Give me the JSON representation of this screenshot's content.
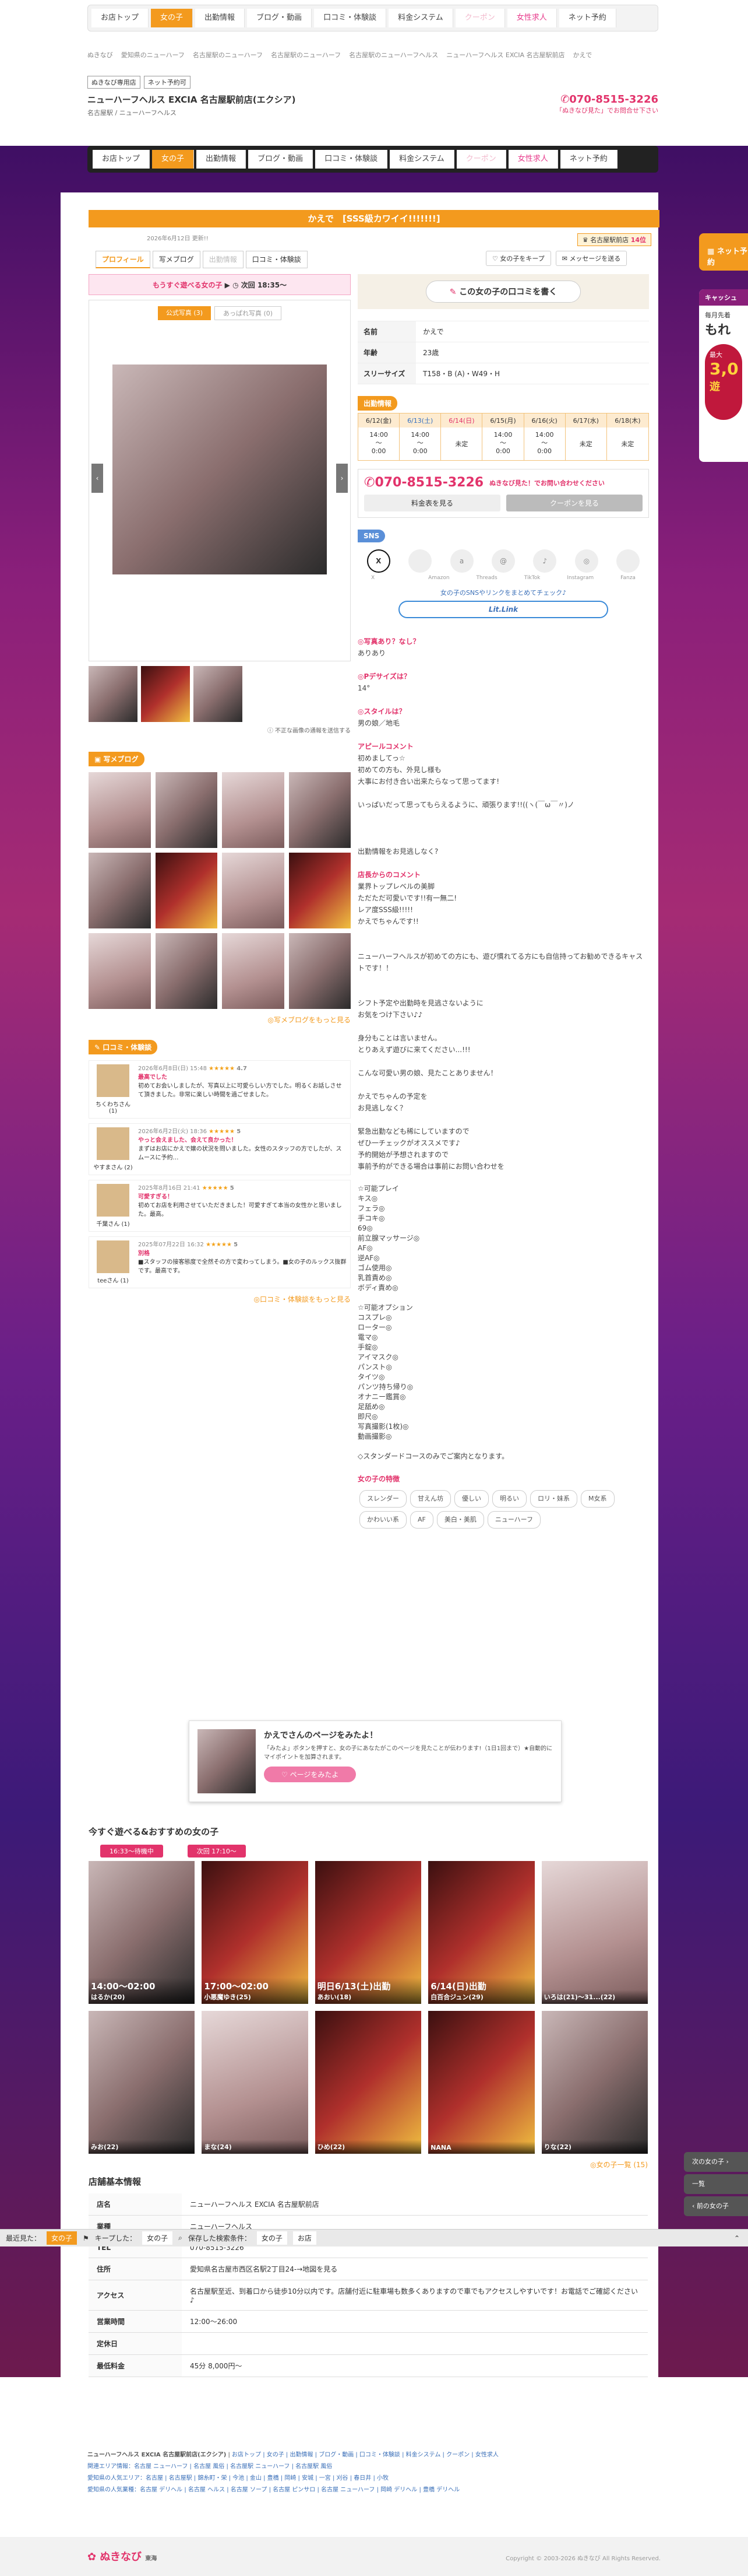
{
  "nav": {
    "items": [
      "お店トップ",
      "女の子",
      "出勤情報",
      "ブログ・動画",
      "口コミ・体験談",
      "料金システム",
      "クーポン",
      "女性求人",
      "ネット予約"
    ],
    "active": 1
  },
  "breadcrumb": [
    "ぬきなび",
    "愛知県のニューハーフ",
    "名古屋駅のニューハーフ",
    "名古屋駅のニューハーフ",
    "名古屋駅のニューハーフヘルス",
    "ニューハーフヘルス EXCIA 名古屋駅前店",
    "かえで"
  ],
  "shop": {
    "tags": [
      "ぬきなび専用店",
      "ネット予約可"
    ],
    "name": "ニューハーフヘルス EXCIA 名古屋駅前店(エクシア)",
    "area": "名古屋駅 / ニューハーフヘルス",
    "phone": "070-8515-3226",
    "note": "「ぬきなび見た」でお問合せ下さい"
  },
  "title": "かえで　[SSS級カワイイ!!!!!!!]",
  "date": "2026年6月12日 更新!!",
  "rank": {
    "label": "名古屋駅前店",
    "count": "14位"
  },
  "tabs": [
    "プロフィール",
    "写メブログ",
    "出勤情報",
    "口コミ・体験談"
  ],
  "top_buttons": {
    "fav": "女の子をキープ",
    "mail": "メッセージを送る"
  },
  "now": {
    "label": "もうすぐ遊べる女の子",
    "time": "次回 18:35〜"
  },
  "photo_tabs": [
    "公式写真 (3)",
    "あっぱれ写真 (0)"
  ],
  "photo_note": "不正な画像の通報を送信する",
  "review_btn": "この女の子の口コミを書く",
  "profile": {
    "rows": [
      {
        "k": "名前",
        "v": "かえで"
      },
      {
        "k": "年齢",
        "v": "23歳"
      },
      {
        "k": "スリーサイズ",
        "v": "T158・B (A)・W49・H"
      }
    ]
  },
  "schedule": {
    "title": "出勤情報",
    "days": [
      "6/12(金)",
      "6/13(土)",
      "6/14(日)",
      "6/15(月)",
      "6/16(火)",
      "6/17(水)",
      "6/18(木)"
    ],
    "times": [
      [
        "14:00",
        "〜",
        "0:00"
      ],
      [
        "14:00",
        "〜",
        "0:00"
      ],
      [
        "未定"
      ],
      [
        "14:00",
        "〜",
        "0:00"
      ],
      [
        "14:00",
        "〜",
        "0:00"
      ],
      [
        "未定"
      ],
      [
        "未定"
      ]
    ]
  },
  "contact": {
    "phone": "070-8515-3226",
    "note": "ぬきなび見た！でお問い合わせください",
    "price_btn": "料金表を見る",
    "coupon_btn": "クーポンを見る"
  },
  "sns": {
    "title": "SNS",
    "items": [
      "X",
      "",
      "Amazon",
      "Threads",
      "TikTok",
      "Instagram",
      "",
      "Fanza"
    ],
    "link_text": "女の子のSNSやリンクをまとめてチェック♪",
    "lit": "Lit.Link"
  },
  "qa": [
    {
      "q": "写真あり？なし？",
      "a": "ありあり"
    },
    {
      "q": "Pデサイズは？",
      "a": "14°"
    },
    {
      "q": "スタイルは？",
      "a": "男の娘／地毛"
    }
  ],
  "appeal": {
    "title": "アピールコメント",
    "lines": [
      "初めましてっ☆",
      "",
      "初めての方も、外見し様も",
      "大事にお付き合い出来たらなって思ってます!",
      "",
      "いっぱいだって思ってもらえるように、頑張ります!!((ヽ(￣ω￣〃)ノ",
      "",
      "",
      "",
      "出勤情報をお見逃しなく?"
    ]
  },
  "shop_comment": {
    "title": "店長からのコメント",
    "lines": [
      "業界トップレベルの美脚",
      "ただただ可愛いです!!有一無二!",
      "レア度SSS級!!!!!",
      "かえでちゃんです!!",
      "",
      "",
      "ニューハーフヘルスが初めての方にも、遊び慣れてる方にも自信持ってお勧めできるキャストです！！",
      "",
      "",
      "シフト予定や出勤時を見逃さないように",
      "お気をつけ下さい♪♪",
      "",
      "身分もことは言いません。",
      "とりあえず遊びに来てください...!!!",
      "",
      "こんな可愛い男の娘、見たことありません！",
      "",
      "かえでちゃんの予定を",
      "お見逃しなく？",
      "",
      "緊急出勤なども稀にしていますので",
      "ぜひ一チェックがオススメです♪",
      "予約開始が予想されますので",
      "事前予約ができる場合は事前にお問い合わせを"
    ]
  },
  "options": {
    "title": "☆可能プレイ",
    "lines": [
      "キス◎",
      "フェラ◎",
      "手コキ◎",
      "69◎",
      "前立腺マッサージ◎",
      "AF◎",
      "逆AF◎",
      "ゴム使用◎",
      "乳首責め◎",
      "ボディ責め◎"
    ],
    "title2": "☆可能オプション",
    "lines2": [
      "コスプレ◎",
      "ローター◎",
      "電マ◎",
      "手錠◎",
      "アイマスク◎",
      "パンスト◎",
      "タイツ◎",
      "パンツ持ち帰り◎",
      "オナニー鑑賞◎",
      "足舐め◎",
      "即尺◎",
      "写真撮影(1枚)◎",
      "動画撮影◎"
    ],
    "footer": "◇スタンダードコースのみでご案内となります。"
  },
  "features": {
    "title": "女の子の特徴",
    "items": [
      "スレンダー",
      "甘えん坊",
      "優しい",
      "明るい",
      "ロリ・妹系",
      "M女系",
      "かわいい系",
      "AF",
      "美白・美肌",
      "ニューハーフ"
    ]
  },
  "blog": {
    "title": "写メブログ",
    "more": "写メブログをもっと見る"
  },
  "reviews": {
    "title": "口コミ・体験談",
    "items": [
      {
        "user": "ちくわちさん (1)",
        "date": "2026年6月8日(日) 15:48",
        "rating": "4.7",
        "title": "最高でした",
        "text": "初めてお会いしましたが、写真以上に可愛らしい方でした。明るくお話しさせて頂きました。非常に楽しい時間を過ごせました。"
      },
      {
        "user": "やすまさん (2)",
        "date": "2026年6月2日(火) 18:36",
        "rating": "5",
        "title": "やっと会えました、会えて良かった！",
        "text": "まずはお店にかえで嬢の状況を問いました。女性のスタッフの方でしたが、スムースに予約…"
      },
      {
        "user": "千葉さん (1)",
        "date": "2025年8月16日 21:41",
        "rating": "5",
        "title": "可愛すぎる！",
        "text": "初めてお店を利用させていただきました！可愛すぎて本当の女性かと思いました。最高。"
      },
      {
        "user": "teeさん (1)",
        "date": "2025年07月22日 16:32",
        "rating": "5",
        "title": "別格",
        "text": "■スタッフの接客態度で全然その方で変わってしまう。■女の子のルックス抜群です。最高です。"
      }
    ],
    "more": "口コミ・体験談をもっと見る"
  },
  "promo": {
    "title": "かえでさんのページをみたよ！",
    "text": "「みたよ」ボタンを押すと、女の子にあなたがこのページを見たことが伝わります!（1日1回まで）★自動的にマイポイントを加算されます。",
    "btn": "ページをみたよ"
  },
  "recommend": {
    "title": "今すぐ遊べる&おすすめの女の子",
    "badges": [
      "16:33〜待機中",
      "次回 17:10〜"
    ],
    "cards": [
      {
        "time": "14:00〜02:00",
        "name": "はるか(20)"
      },
      {
        "time": "17:00〜02:00",
        "name": "小悪魔ゆき(25)"
      },
      {
        "time": "明日6/13(土)出勤",
        "name": "あおい(18)"
      },
      {
        "time": "6/14(日)出勤",
        "name": "白百合ジュン(29)"
      },
      {
        "time": "",
        "name": "いろは(21)〜31...(22)"
      },
      {
        "time": "",
        "name": "みお(22)"
      },
      {
        "time": "",
        "name": "まな(24)"
      },
      {
        "time": "",
        "name": "ひめ(22)"
      },
      {
        "time": "",
        "name": "NANA"
      },
      {
        "time": "",
        "name": "りな(22)"
      }
    ],
    "more": "女の子一覧 (15)"
  },
  "shopinfo": {
    "title": "店舗基本情報",
    "rows": [
      {
        "k": "店名",
        "v": "ニューハーフヘルス EXCIA 名古屋駅前店"
      },
      {
        "k": "業種",
        "v": "ニューハーフヘルス"
      },
      {
        "k": "TEL",
        "v": "070-8515-3226"
      },
      {
        "k": "住所",
        "v": "愛知県名古屋市西区名駅2丁目24-→地図を見る"
      },
      {
        "k": "アクセス",
        "v": "名古屋駅至近、到着口から徒歩10分以内です。店舗付近に駐車場も数多くありますので車でもアクセスしやすいです！お電話でご確認ください♪"
      },
      {
        "k": "営業時間",
        "v": "12:00〜26:00"
      },
      {
        "k": "定休日",
        "v": ""
      },
      {
        "k": "最低料金",
        "v": "45分 8,000円〜"
      }
    ]
  },
  "bottombar": {
    "items": [
      "最近見た：",
      "女の子",
      "キープした：",
      "女の子",
      "保存した検索条件：",
      "女の子",
      "お店"
    ]
  },
  "side": {
    "next": "次の女の子",
    "list": "一覧",
    "prev": "前の女の子",
    "net": "ネット予約"
  },
  "ad": {
    "title": "キャッシュ",
    "line1": "毎月先着",
    "line2": "もれ",
    "line3": "最大",
    "line4": "3,0",
    "line5": "遊"
  },
  "footer": {
    "shopline": "ニューハーフヘルス EXCIA 名古屋駅前店(エクシア)",
    "links": "お店トップ | 女の子 | 出勤情報 | ブログ・動画 | 口コミ・体験談 | 料金システム | クーポン | 女性求人",
    "area": "関連エリア情報：名古屋 ニューハーフ | 名古屋 風俗 | 名古屋駅 ニューハーフ | 名古屋駅 風俗",
    "pop": "愛知県の人気エリア：名古屋 | 名古屋駅 | 錦糸町・栄 | 今池 | 金山 | 豊橋 | 岡崎 | 安城 | 一宮 | 刈谷 | 春日井 | 小牧",
    "pop2": "愛知県の人気業種：名古屋 デリヘル | 名古屋 ヘルス | 名古屋 ソープ | 名古屋 ピンサロ | 名古屋 ニューハーフ | 岡崎 デリヘル | 豊橋 デリヘル",
    "copy": "Copyright © 2003-2026 ぬきなび All Rights Reserved.",
    "logo": "ぬきなび",
    "logo_sub": "東海"
  }
}
